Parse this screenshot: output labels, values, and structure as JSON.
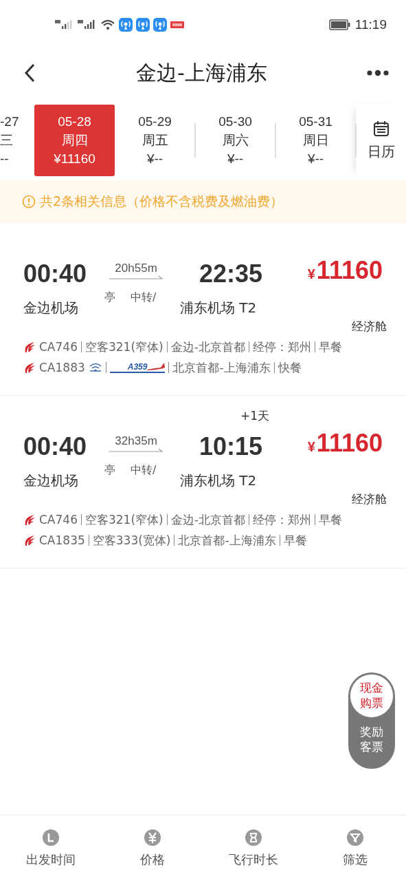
{
  "status_bar": {
    "time": "11:19"
  },
  "header": {
    "title": "金边-上海浦东"
  },
  "date_tabs": [
    {
      "date": "-27",
      "weekday": "三",
      "price": "--",
      "selected": false,
      "partial": true
    },
    {
      "date": "05-28",
      "weekday": "周四",
      "price": "¥11160",
      "selected": true,
      "partial": false
    },
    {
      "date": "05-29",
      "weekday": "周五",
      "price": "¥--",
      "selected": false,
      "partial": false
    },
    {
      "date": "05-30",
      "weekday": "周六",
      "price": "¥--",
      "selected": false,
      "partial": false
    },
    {
      "date": "05-31",
      "weekday": "周日",
      "price": "¥--",
      "selected": false,
      "partial": false
    }
  ],
  "calendar_button": {
    "label": "日历"
  },
  "notice": {
    "text": "共2条相关信息（价格不含税费及燃油费）"
  },
  "flights": [
    {
      "dep_time": "00:40",
      "duration": "20h55m",
      "stop_labels": [
        "亭",
        "中转/"
      ],
      "arr_time": "22:35",
      "price_currency": "¥",
      "price": "11160",
      "dep_airport": "金边机场",
      "arr_airport": "浦东机场 T2",
      "cabin": "经济舱",
      "segments": [
        {
          "flight_no": "CA746",
          "wifi": false,
          "parts": [
            {
              "kind": "text",
              "text": "空客321(窄体)"
            },
            {
              "kind": "text",
              "text": "金边-北京首都"
            },
            {
              "kind": "text",
              "text": "经停：郑州"
            },
            {
              "kind": "text",
              "text": "早餐"
            }
          ]
        },
        {
          "flight_no": "CA1883",
          "wifi": true,
          "parts": [
            {
              "kind": "badge",
              "text": "A359"
            },
            {
              "kind": "text",
              "text": "北京首都-上海浦东"
            },
            {
              "kind": "text",
              "text": "快餐"
            }
          ]
        }
      ]
    },
    {
      "dep_time": "00:40",
      "duration": "32h35m",
      "stop_labels": [
        "亭",
        "中转/"
      ],
      "arr_time": "10:15",
      "day_offset": "+1天",
      "price_currency": "¥",
      "price": "11160",
      "dep_airport": "金边机场",
      "arr_airport": "浦东机场 T2",
      "cabin": "经济舱",
      "segments": [
        {
          "flight_no": "CA746",
          "wifi": false,
          "parts": [
            {
              "kind": "text",
              "text": "空客321(窄体)"
            },
            {
              "kind": "text",
              "text": "金边-北京首都"
            },
            {
              "kind": "text",
              "text": "经停：郑州"
            },
            {
              "kind": "text",
              "text": "早餐"
            }
          ]
        },
        {
          "flight_no": "CA1835",
          "wifi": false,
          "parts": [
            {
              "kind": "text",
              "text": "空客333(宽体)"
            },
            {
              "kind": "text",
              "text": "北京首都-上海浦东"
            },
            {
              "kind": "text",
              "text": "早餐"
            }
          ]
        }
      ]
    }
  ],
  "ticket_toggle": [
    {
      "label": "现金购票",
      "selected": true
    },
    {
      "label": "奖励客票",
      "selected": false
    }
  ],
  "bottom_nav": [
    {
      "label": "出发时间"
    },
    {
      "label": "价格"
    },
    {
      "label": "飞行时长"
    },
    {
      "label": "筛选"
    }
  ]
}
